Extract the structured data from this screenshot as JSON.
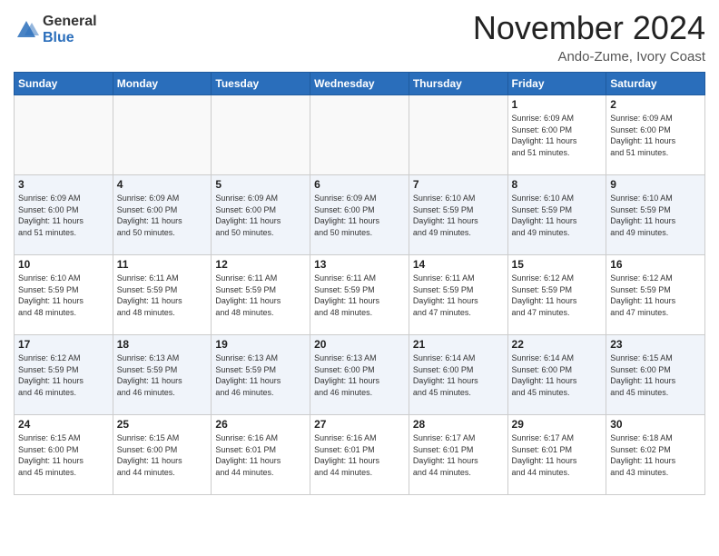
{
  "header": {
    "logo_general": "General",
    "logo_blue": "Blue",
    "month": "November 2024",
    "location": "Ando-Zume, Ivory Coast"
  },
  "weekdays": [
    "Sunday",
    "Monday",
    "Tuesday",
    "Wednesday",
    "Thursday",
    "Friday",
    "Saturday"
  ],
  "weeks": [
    [
      {
        "day": "",
        "info": ""
      },
      {
        "day": "",
        "info": ""
      },
      {
        "day": "",
        "info": ""
      },
      {
        "day": "",
        "info": ""
      },
      {
        "day": "",
        "info": ""
      },
      {
        "day": "1",
        "info": "Sunrise: 6:09 AM\nSunset: 6:00 PM\nDaylight: 11 hours\nand 51 minutes."
      },
      {
        "day": "2",
        "info": "Sunrise: 6:09 AM\nSunset: 6:00 PM\nDaylight: 11 hours\nand 51 minutes."
      }
    ],
    [
      {
        "day": "3",
        "info": "Sunrise: 6:09 AM\nSunset: 6:00 PM\nDaylight: 11 hours\nand 51 minutes."
      },
      {
        "day": "4",
        "info": "Sunrise: 6:09 AM\nSunset: 6:00 PM\nDaylight: 11 hours\nand 50 minutes."
      },
      {
        "day": "5",
        "info": "Sunrise: 6:09 AM\nSunset: 6:00 PM\nDaylight: 11 hours\nand 50 minutes."
      },
      {
        "day": "6",
        "info": "Sunrise: 6:09 AM\nSunset: 6:00 PM\nDaylight: 11 hours\nand 50 minutes."
      },
      {
        "day": "7",
        "info": "Sunrise: 6:10 AM\nSunset: 5:59 PM\nDaylight: 11 hours\nand 49 minutes."
      },
      {
        "day": "8",
        "info": "Sunrise: 6:10 AM\nSunset: 5:59 PM\nDaylight: 11 hours\nand 49 minutes."
      },
      {
        "day": "9",
        "info": "Sunrise: 6:10 AM\nSunset: 5:59 PM\nDaylight: 11 hours\nand 49 minutes."
      }
    ],
    [
      {
        "day": "10",
        "info": "Sunrise: 6:10 AM\nSunset: 5:59 PM\nDaylight: 11 hours\nand 48 minutes."
      },
      {
        "day": "11",
        "info": "Sunrise: 6:11 AM\nSunset: 5:59 PM\nDaylight: 11 hours\nand 48 minutes."
      },
      {
        "day": "12",
        "info": "Sunrise: 6:11 AM\nSunset: 5:59 PM\nDaylight: 11 hours\nand 48 minutes."
      },
      {
        "day": "13",
        "info": "Sunrise: 6:11 AM\nSunset: 5:59 PM\nDaylight: 11 hours\nand 48 minutes."
      },
      {
        "day": "14",
        "info": "Sunrise: 6:11 AM\nSunset: 5:59 PM\nDaylight: 11 hours\nand 47 minutes."
      },
      {
        "day": "15",
        "info": "Sunrise: 6:12 AM\nSunset: 5:59 PM\nDaylight: 11 hours\nand 47 minutes."
      },
      {
        "day": "16",
        "info": "Sunrise: 6:12 AM\nSunset: 5:59 PM\nDaylight: 11 hours\nand 47 minutes."
      }
    ],
    [
      {
        "day": "17",
        "info": "Sunrise: 6:12 AM\nSunset: 5:59 PM\nDaylight: 11 hours\nand 46 minutes."
      },
      {
        "day": "18",
        "info": "Sunrise: 6:13 AM\nSunset: 5:59 PM\nDaylight: 11 hours\nand 46 minutes."
      },
      {
        "day": "19",
        "info": "Sunrise: 6:13 AM\nSunset: 5:59 PM\nDaylight: 11 hours\nand 46 minutes."
      },
      {
        "day": "20",
        "info": "Sunrise: 6:13 AM\nSunset: 6:00 PM\nDaylight: 11 hours\nand 46 minutes."
      },
      {
        "day": "21",
        "info": "Sunrise: 6:14 AM\nSunset: 6:00 PM\nDaylight: 11 hours\nand 45 minutes."
      },
      {
        "day": "22",
        "info": "Sunrise: 6:14 AM\nSunset: 6:00 PM\nDaylight: 11 hours\nand 45 minutes."
      },
      {
        "day": "23",
        "info": "Sunrise: 6:15 AM\nSunset: 6:00 PM\nDaylight: 11 hours\nand 45 minutes."
      }
    ],
    [
      {
        "day": "24",
        "info": "Sunrise: 6:15 AM\nSunset: 6:00 PM\nDaylight: 11 hours\nand 45 minutes."
      },
      {
        "day": "25",
        "info": "Sunrise: 6:15 AM\nSunset: 6:00 PM\nDaylight: 11 hours\nand 44 minutes."
      },
      {
        "day": "26",
        "info": "Sunrise: 6:16 AM\nSunset: 6:01 PM\nDaylight: 11 hours\nand 44 minutes."
      },
      {
        "day": "27",
        "info": "Sunrise: 6:16 AM\nSunset: 6:01 PM\nDaylight: 11 hours\nand 44 minutes."
      },
      {
        "day": "28",
        "info": "Sunrise: 6:17 AM\nSunset: 6:01 PM\nDaylight: 11 hours\nand 44 minutes."
      },
      {
        "day": "29",
        "info": "Sunrise: 6:17 AM\nSunset: 6:01 PM\nDaylight: 11 hours\nand 44 minutes."
      },
      {
        "day": "30",
        "info": "Sunrise: 6:18 AM\nSunset: 6:02 PM\nDaylight: 11 hours\nand 43 minutes."
      }
    ]
  ]
}
